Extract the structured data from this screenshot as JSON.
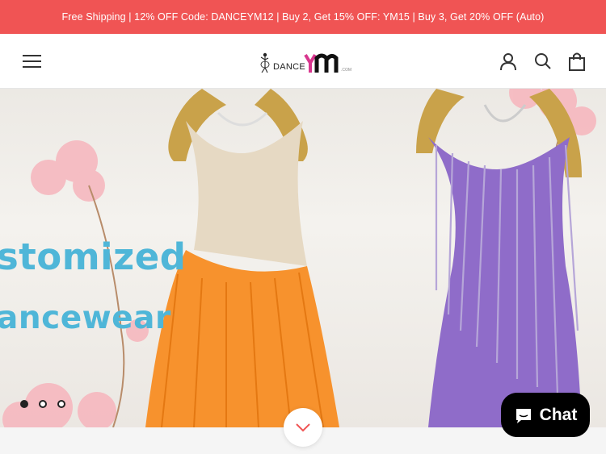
{
  "announcement": {
    "text": "Free Shipping | 12% OFF Code: DANCEYM12 | Buy 2, Get 15% OFF: YM15 | Buy 3, Get 20% OFF (Auto)"
  },
  "header": {
    "menu_icon": "hamburger-icon",
    "logo": {
      "text": "DANCE",
      "suffix": ".COM"
    },
    "icons": [
      "account-icon",
      "search-icon",
      "cart-icon"
    ]
  },
  "hero": {
    "headline_line1": "stomized",
    "headline_line2": "ancewear",
    "slides": [
      {
        "active": true
      },
      {
        "active": false
      },
      {
        "active": false
      }
    ]
  },
  "chat": {
    "label": "Chat"
  },
  "colors": {
    "announcement_bg": "#f05454",
    "hero_text": "#4fb6d8",
    "orange_dress": "#f7922d",
    "purple_dress": "#8f6cc9"
  }
}
